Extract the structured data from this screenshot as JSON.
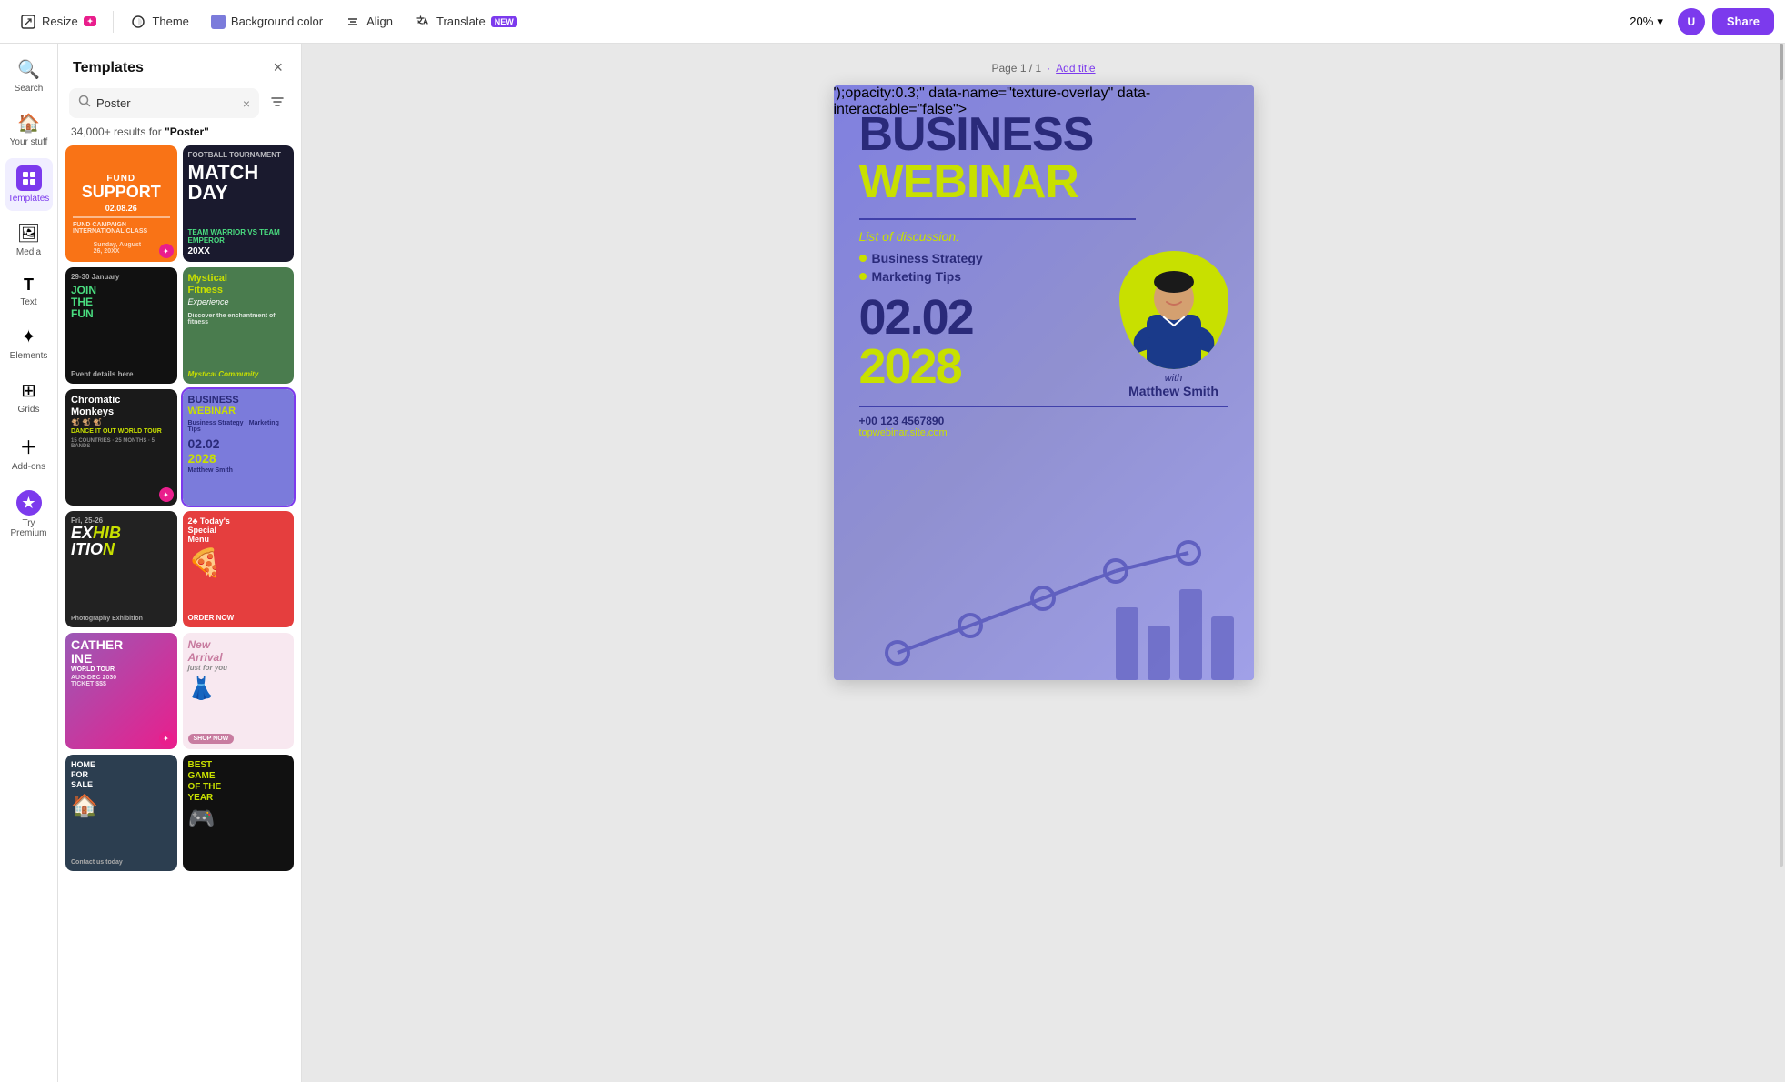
{
  "toolbar": {
    "resize_label": "Resize",
    "theme_label": "Theme",
    "bg_color_label": "Background color",
    "align_label": "Align",
    "translate_label": "Translate",
    "translate_badge": "NEW",
    "zoom_level": "20%",
    "share_label": "Share"
  },
  "sidebar": {
    "items": [
      {
        "id": "search",
        "label": "Search",
        "icon": "🔍"
      },
      {
        "id": "your-stuff",
        "label": "Your stuff",
        "icon": "🏠"
      },
      {
        "id": "templates",
        "label": "Templates",
        "icon": "⊞",
        "active": true
      },
      {
        "id": "media",
        "label": "Media",
        "icon": "🖼"
      },
      {
        "id": "text",
        "label": "Text",
        "icon": "T"
      },
      {
        "id": "elements",
        "label": "Elements",
        "icon": "✦"
      },
      {
        "id": "grids",
        "label": "Grids",
        "icon": "⊞"
      },
      {
        "id": "add-ons",
        "label": "Add-ons",
        "icon": "＋"
      },
      {
        "id": "try-premium",
        "label": "Try Premium",
        "icon": "★"
      }
    ]
  },
  "templates_panel": {
    "title": "Templates",
    "close_label": "×",
    "search_value": "Poster",
    "search_placeholder": "Poster",
    "results_text": "34,000+ results for",
    "results_query": "\"Poster\"",
    "filter_label": "Filter"
  },
  "template_cards": [
    {
      "id": 1,
      "bg": "#f97316",
      "title": "FUND SUPPORT",
      "subtitle": "02.08.26",
      "style": "orange",
      "premium": true
    },
    {
      "id": 2,
      "bg": "#1a1a2e",
      "title": "FOOTBALL TOURNAMENT",
      "subtitle": "MATCH DAY",
      "style": "dark-sports",
      "premium": false
    },
    {
      "id": 3,
      "bg": "#111",
      "title": "JOIN THE FUN",
      "subtitle": "",
      "style": "dark",
      "premium": false
    },
    {
      "id": 4,
      "bg": "#4a7c4e",
      "title": "Mystical Fitness Experience",
      "subtitle": "",
      "style": "green",
      "premium": false
    },
    {
      "id": 5,
      "bg": "#1a1a1a",
      "title": "Chromatic Monkeys",
      "subtitle": "DANCE IT OUT WORLD TOUR",
      "style": "band",
      "premium": true
    },
    {
      "id": 6,
      "bg": "#7b7bdb",
      "title": "BUSINESS WEBINAR",
      "subtitle": "02.02 2028",
      "style": "webinar",
      "premium": false
    },
    {
      "id": 7,
      "bg": "#222",
      "title": "EXHIBITION",
      "subtitle": "",
      "style": "exhibition",
      "premium": false
    },
    {
      "id": 8,
      "bg": "#e53e3e",
      "title": "Today's Special Menu",
      "subtitle": "",
      "style": "pizza",
      "premium": false
    },
    {
      "id": 9,
      "bg": "#9b59b6",
      "title": "CATHERINE",
      "subtitle": "WORLD TOUR",
      "style": "concert",
      "premium": true
    },
    {
      "id": 10,
      "bg": "#f8e8f0",
      "title": "New Arrival",
      "subtitle": "just for you",
      "style": "fashion",
      "premium": false
    },
    {
      "id": 11,
      "bg": "#2c3e50",
      "title": "HOME FOR SALE",
      "subtitle": "",
      "style": "realestate",
      "premium": false
    },
    {
      "id": 12,
      "bg": "#1a1a1a",
      "title": "BEST GAME OF THE YEAR",
      "subtitle": "",
      "style": "game",
      "premium": false
    }
  ],
  "canvas": {
    "page_label": "Page 1 / 1",
    "add_title": "Add title"
  },
  "poster": {
    "title_line1": "BUSINESS",
    "title_line2": "WEBINAR",
    "discussion_label": "List of discussion:",
    "bullet1": "Business Strategy",
    "bullet2": "Marketing Tips",
    "date": "02.02",
    "year": "2028",
    "with_label": "with",
    "speaker_name": "Matthew Smith",
    "phone": "+00 123 4567890",
    "website": "topwebinar.site.com"
  }
}
